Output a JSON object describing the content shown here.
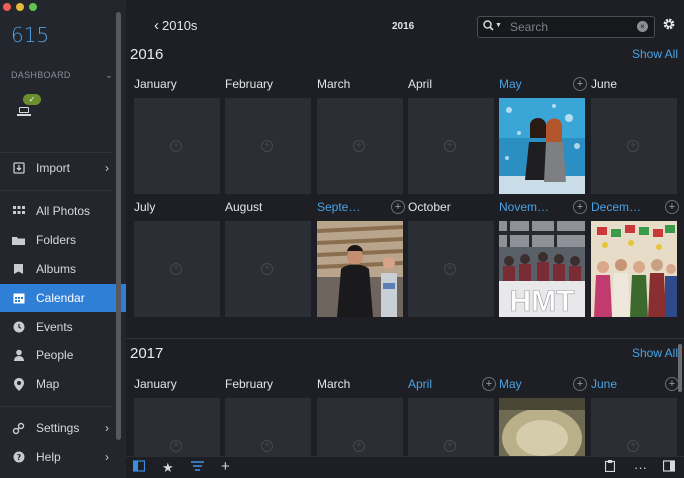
{
  "app": {
    "count": "615"
  },
  "sidebar": {
    "dashboard_label": "DASHBOARD",
    "device_badge": "✓",
    "items": [
      {
        "label": "Import",
        "icon": "import-icon"
      },
      {
        "label": "All Photos",
        "icon": "grid-icon"
      },
      {
        "label": "Folders",
        "icon": "folder-icon"
      },
      {
        "label": "Albums",
        "icon": "albums-icon"
      },
      {
        "label": "Calendar",
        "icon": "calendar-icon",
        "active": true
      },
      {
        "label": "Events",
        "icon": "clock-icon"
      },
      {
        "label": "People",
        "icon": "person-icon"
      },
      {
        "label": "Map",
        "icon": "map-pin-icon"
      },
      {
        "label": "Settings",
        "icon": "settings-icon"
      },
      {
        "label": "Help",
        "icon": "help-icon"
      }
    ]
  },
  "topbar": {
    "back_label": "2010s",
    "current": "2016",
    "search_placeholder": "Search"
  },
  "years": [
    {
      "title": "2016",
      "show_all": "Show All",
      "months": [
        {
          "label": "January",
          "highlight": false,
          "has_photo": false
        },
        {
          "label": "February",
          "highlight": false,
          "has_photo": false
        },
        {
          "label": "March",
          "highlight": false,
          "has_photo": false
        },
        {
          "label": "April",
          "highlight": false,
          "has_photo": false
        },
        {
          "label": "May",
          "highlight": true,
          "has_photo": true
        },
        {
          "label": "June",
          "highlight": false,
          "has_photo": false
        },
        {
          "label": "July",
          "highlight": false,
          "has_photo": false
        },
        {
          "label": "August",
          "highlight": false,
          "has_photo": false
        },
        {
          "label": "Septe…",
          "highlight": true,
          "has_photo": true
        },
        {
          "label": "October",
          "highlight": false,
          "has_photo": false
        },
        {
          "label": "Novem…",
          "highlight": true,
          "has_photo": true
        },
        {
          "label": "Decem…",
          "highlight": true,
          "has_photo": true
        }
      ]
    },
    {
      "title": "2017",
      "show_all": "Show All",
      "months": [
        {
          "label": "January",
          "highlight": false,
          "has_photo": false
        },
        {
          "label": "February",
          "highlight": false,
          "has_photo": false
        },
        {
          "label": "March",
          "highlight": false,
          "has_photo": false
        },
        {
          "label": "April",
          "highlight": true,
          "has_photo": false
        },
        {
          "label": "May",
          "highlight": true,
          "has_photo": true
        },
        {
          "label": "June",
          "highlight": true,
          "has_photo": false
        }
      ]
    }
  ],
  "photo_text": {
    "hmt": "HMT"
  },
  "colors": {
    "accent": "#4aa3e6",
    "active_row": "#2f7fd6",
    "background": "#1d1f24",
    "tile": "#2b2e34"
  }
}
